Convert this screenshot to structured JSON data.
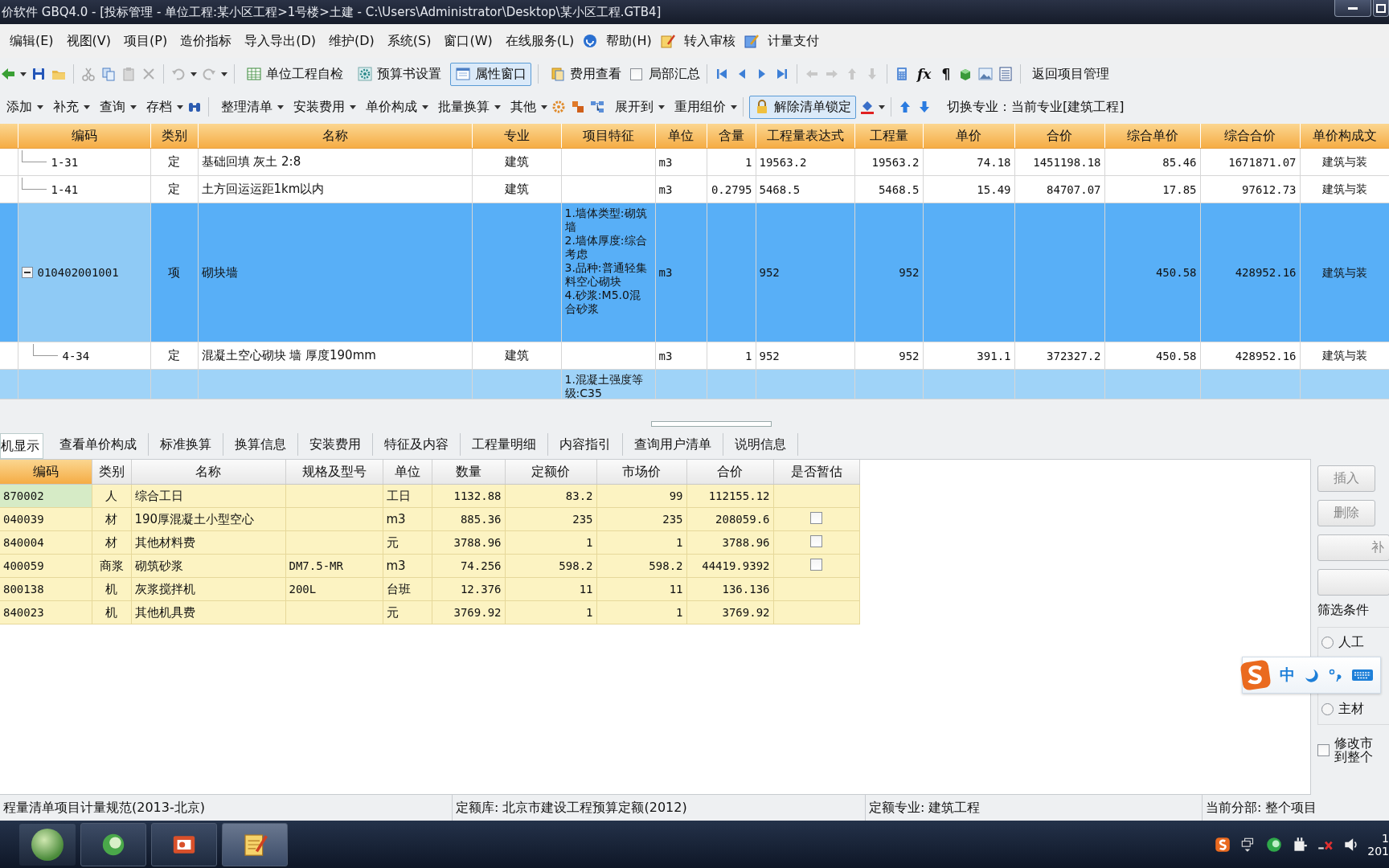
{
  "window": {
    "title": "价软件 GBQ4.0 - [投标管理 - 单位工程:某小区工程>1号楼>土建 - C:\\Users\\Administrator\\Desktop\\某小区工程.GTB4]"
  },
  "menu": [
    {
      "label": "编辑(E)",
      "kind": "text"
    },
    {
      "label": "视图(V)",
      "kind": "text"
    },
    {
      "label": "项目(P)",
      "kind": "text"
    },
    {
      "label": "造价指标",
      "kind": "text"
    },
    {
      "label": "导入导出(D)",
      "kind": "text"
    },
    {
      "label": "维护(D)",
      "kind": "text"
    },
    {
      "label": "系统(S)",
      "kind": "text"
    },
    {
      "label": "窗口(W)",
      "kind": "text"
    },
    {
      "label": "在线服务(L)",
      "kind": "text"
    },
    {
      "label": "帮助(H)",
      "kind": "help"
    },
    {
      "label": "转入审核",
      "kind": "review"
    },
    {
      "label": "计量支付",
      "kind": "payment"
    }
  ],
  "toolbar": {
    "buttons": [
      {
        "label": "单位工程自检",
        "selected": false
      },
      {
        "label": "预算书设置",
        "selected": false
      },
      {
        "label": "属性窗口",
        "selected": true
      },
      {
        "label": "费用查看",
        "selected": false
      }
    ],
    "summary_checkbox": {
      "label": "局部汇总",
      "checked": false
    },
    "glyphs": [
      "fx",
      "¶"
    ],
    "return_button": "返回项目管理"
  },
  "toolbar2": {
    "left_menus": [
      "添加",
      "补充",
      "查询",
      "存档"
    ],
    "menus": [
      "整理清单",
      "安装费用",
      "单价构成",
      "批量换算",
      "其他"
    ],
    "expand_menus": [
      "展开到",
      "重用组价"
    ],
    "lock_button": {
      "label": "解除清单锁定",
      "selected": true
    },
    "specialty": "切换专业：当前专业[建筑工程]"
  },
  "table": {
    "columns": [
      "编码",
      "类别",
      "名称",
      "专业",
      "项目特征",
      "单位",
      "含量",
      "工程量表达式",
      "工程量",
      "单价",
      "合价",
      "综合单价",
      "综合合价",
      "单价构成文"
    ],
    "rows": [
      {
        "kind": "quota",
        "selected": false,
        "code": "1-31",
        "type": "定",
        "name": "基础回填 灰土 2:8",
        "specialty": "建筑",
        "unit": "m3",
        "content": "1",
        "expr": "19563.2",
        "qty": "19563.2",
        "price": "74.18",
        "total": "1451198.18",
        "comp_price": "85.46",
        "comp_total": "1671871.07",
        "template": "建筑与装"
      },
      {
        "kind": "quota",
        "selected": false,
        "code": "1-41",
        "type": "定",
        "name": "土方回运运距1km以内",
        "specialty": "建筑",
        "unit": "m3",
        "content": "0.2795",
        "expr": "5468.5",
        "qty": "5468.5",
        "price": "15.49",
        "total": "84707.07",
        "comp_price": "17.85",
        "comp_total": "97612.73",
        "template": "建筑与装"
      },
      {
        "kind": "item",
        "selected": true,
        "expanded": true,
        "code": "010402001001",
        "type": "项",
        "name": "砌块墙",
        "features": "1.墙体类型:砌筑墙\n2.墙体厚度:综合考虑\n3.品种:普通轻集料空心砌块\n4.砂浆:M5.0混合砂浆",
        "unit": "m3",
        "expr": "952",
        "qty": "952",
        "comp_price": "450.58",
        "comp_total": "428952.16",
        "template": "建筑与装",
        "children": [
          {
            "kind": "quota",
            "selected": false,
            "code": "4-34",
            "type": "定",
            "name": "混凝土空心砌块 墙 厚度190mm",
            "specialty": "建筑",
            "unit": "m3",
            "content": "1",
            "expr": "952",
            "qty": "952",
            "price": "391.1",
            "total": "372327.2",
            "comp_price": "450.58",
            "comp_total": "428952.16",
            "template": "建筑与装"
          }
        ]
      },
      {
        "kind": "item",
        "selected": false,
        "features": "1.混凝土强度等级:C35"
      }
    ]
  },
  "tabs": [
    {
      "label": "机显示",
      "selected": true
    },
    {
      "label": "查看单价构成",
      "selected": false
    },
    {
      "label": "标准换算",
      "selected": false
    },
    {
      "label": "换算信息",
      "selected": false
    },
    {
      "label": "安装费用",
      "selected": false
    },
    {
      "label": "特征及内容",
      "selected": false
    },
    {
      "label": "工程量明细",
      "selected": false
    },
    {
      "label": "内容指引",
      "selected": false
    },
    {
      "label": "查询用户清单",
      "selected": false
    },
    {
      "label": "说明信息",
      "selected": false
    }
  ],
  "resources": {
    "columns": [
      {
        "label": "编码",
        "selected": true
      },
      {
        "label": "类别",
        "selected": false
      },
      {
        "label": "名称",
        "selected": false
      },
      {
        "label": "规格及型号",
        "selected": false
      },
      {
        "label": "单位",
        "selected": false
      },
      {
        "label": "数量",
        "selected": false
      },
      {
        "label": "定额价",
        "selected": false
      },
      {
        "label": "市场价",
        "selected": false
      },
      {
        "label": "合价",
        "selected": false
      },
      {
        "label": "是否暂估",
        "selected": false
      }
    ],
    "rows": [
      {
        "selected": true,
        "code": "870002",
        "type": "人",
        "name": "综合工日",
        "unit": "工日",
        "qty": "1132.88",
        "quota_price": "83.2",
        "market_price": "99",
        "total": "112155.12"
      },
      {
        "selected": false,
        "code": "040039",
        "type": "材",
        "name": "190厚混凝土小型空心",
        "unit": "m3",
        "qty": "885.36",
        "quota_price": "235",
        "market_price": "235",
        "total": "208059.6",
        "provisional": false
      },
      {
        "selected": false,
        "code": "840004",
        "type": "材",
        "name": "其他材料费",
        "unit": "元",
        "qty": "3788.96",
        "quota_price": "1",
        "market_price": "1",
        "total": "3788.96",
        "provisional": false
      },
      {
        "selected": false,
        "code": "400059",
        "type": "商浆",
        "name": "砌筑砂浆",
        "spec": "DM7.5-MR",
        "unit": "m3",
        "qty": "74.256",
        "quota_price": "598.2",
        "market_price": "598.2",
        "total": "44419.9392",
        "provisional": false
      },
      {
        "selected": false,
        "code": "800138",
        "type": "机",
        "name": "灰浆搅拌机",
        "spec": "200L",
        "unit": "台班",
        "qty": "12.376",
        "quota_price": "11",
        "market_price": "11",
        "total": "136.136"
      },
      {
        "selected": false,
        "code": "840023",
        "type": "机",
        "name": "其他机具费",
        "unit": "元",
        "qty": "3769.92",
        "quota_price": "1",
        "market_price": "1",
        "total": "3769.92"
      }
    ]
  },
  "side_panel": {
    "buttons": [
      {
        "label": "插入",
        "disabled": true
      },
      {
        "label": "删除",
        "disabled": true
      },
      {
        "label": "补",
        "disabled": true
      }
    ],
    "filter": {
      "title": "筛选条件",
      "options": [
        {
          "label": "人工",
          "selected": false
        },
        {
          "label": "主材",
          "selected": false
        }
      ]
    },
    "checkbox": {
      "label": "修改市到整个",
      "checked": false
    }
  },
  "ime_bar": {
    "mode": "中"
  },
  "status_bar": [
    "程量清单项目计量规范(2013-北京)",
    "定额库: 北京市建设工程预算定额(2012)",
    "定额专业: 建筑工程",
    "当前分部: 整个项目"
  ],
  "taskbar": {
    "time": "1",
    "date": "201"
  }
}
